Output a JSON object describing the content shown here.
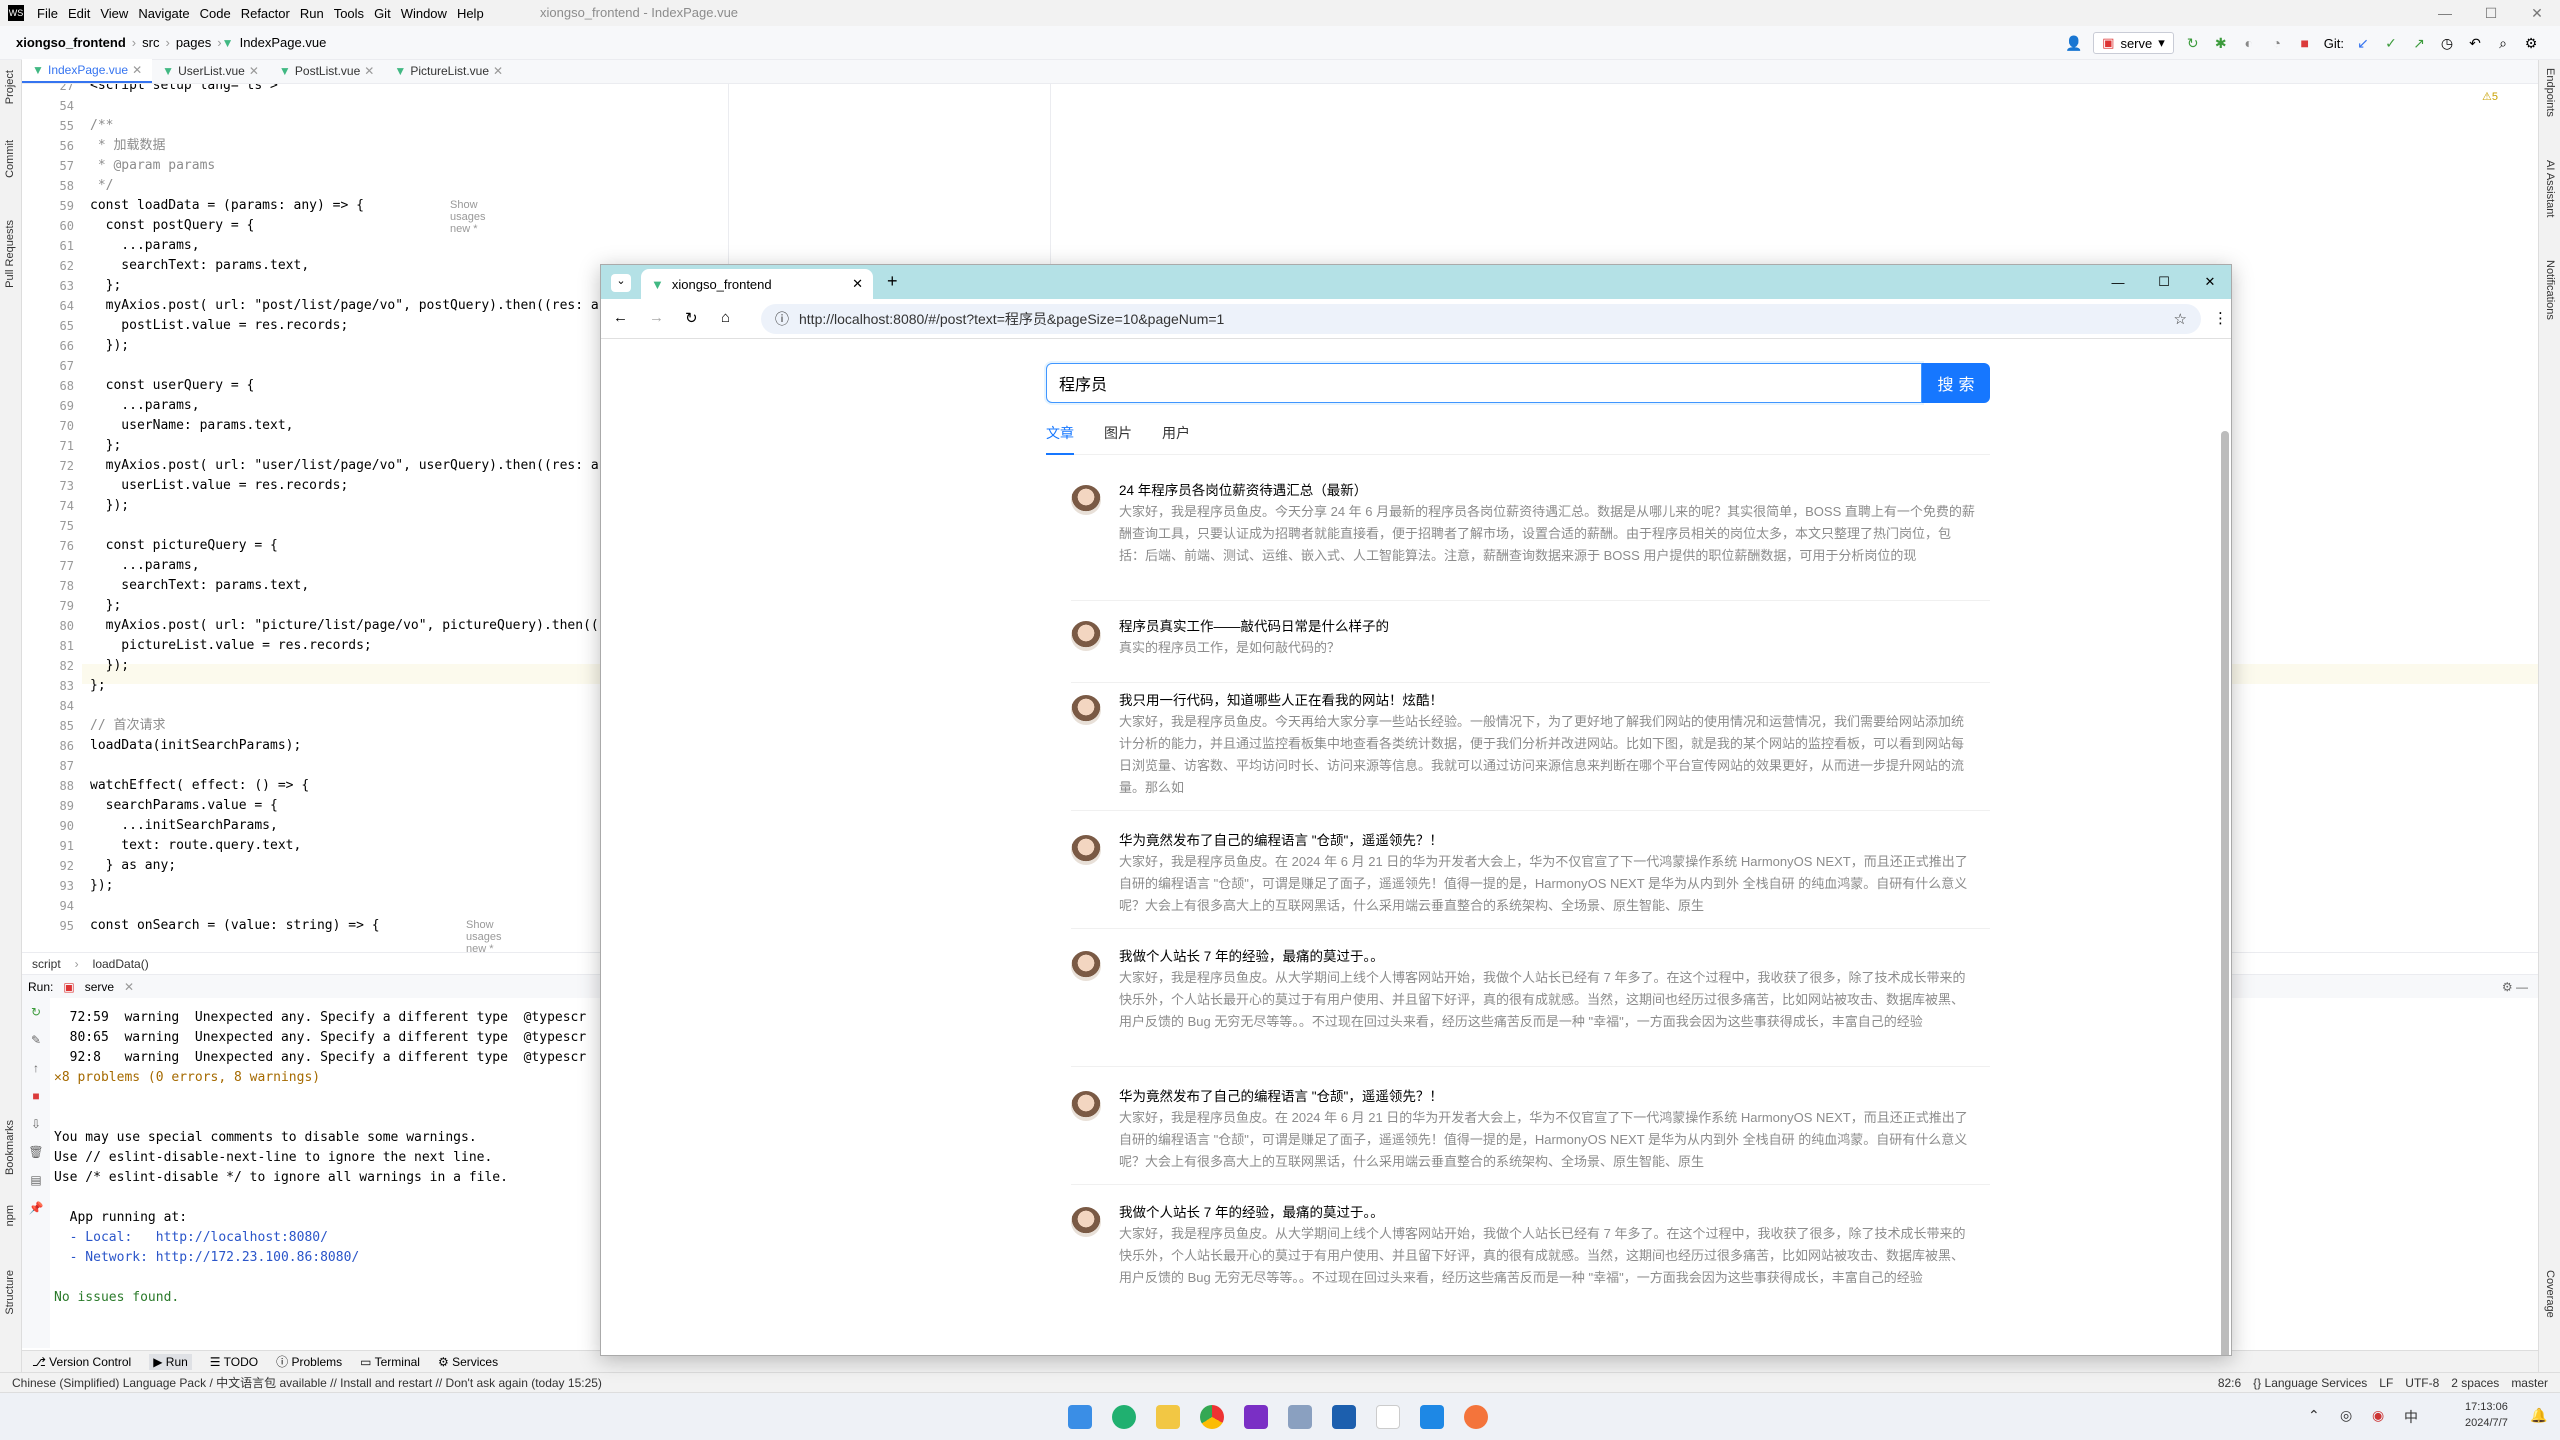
{
  "ide": {
    "menu": [
      "File",
      "Edit",
      "View",
      "Navigate",
      "Code",
      "Refactor",
      "Run",
      "Tools",
      "Git",
      "Window",
      "Help"
    ],
    "window_title": "xiongso_frontend - IndexPage.vue",
    "breadcrumb": [
      "xiongso_frontend",
      "src",
      "pages",
      "IndexPage.vue"
    ],
    "run_config": "serve",
    "git_label": "Git:",
    "tabs": [
      "IndexPage.vue",
      "UserList.vue",
      "PostList.vue",
      "PictureList.vue"
    ],
    "warnings_badge": "⚠5",
    "left_tools": [
      "Project",
      "Commit",
      "Pull Requests",
      "Bookmarks",
      "npm",
      "Structure"
    ],
    "right_tools": [
      "Endpoints",
      "AI Assistant",
      "Notifications",
      "Coverage"
    ],
    "line_numbers": [
      "27",
      "54",
      "55",
      "56",
      "57",
      "58",
      "59",
      "60",
      "61",
      "62",
      "63",
      "64",
      "65",
      "66",
      "67",
      "68",
      "69",
      "70",
      "71",
      "72",
      "73",
      "74",
      "75",
      "76",
      "77",
      "78",
      "79",
      "80",
      "81",
      "82",
      "83",
      "84",
      "85",
      "86",
      "87",
      "88",
      "89",
      "90",
      "91",
      "92",
      "93",
      "94",
      "95"
    ],
    "code_lines": [
      "<script setup lang=\"ts\">",
      "",
      "/**",
      " * 加载数据",
      " * @param params",
      " */",
      "const loadData = (params: any) => {",
      "  const postQuery = {",
      "    ...params,",
      "    searchText: params.text,",
      "  };",
      "  myAxios.post( url: \"post/list/page/vo\", postQuery).then((res: an",
      "    postList.value = res.records;",
      "  });",
      "",
      "  const userQuery = {",
      "    ...params,",
      "    userName: params.text,",
      "  };",
      "  myAxios.post( url: \"user/list/page/vo\", userQuery).then((res: an",
      "    userList.value = res.records;",
      "  });",
      "",
      "  const pictureQuery = {",
      "    ...params,",
      "    searchText: params.text,",
      "  };",
      "  myAxios.post( url: \"picture/list/page/vo\", pictureQuery).then((r",
      "    pictureList.value = res.records;",
      "  });",
      "};",
      "",
      "// 首次请求",
      "loadData(initSearchParams);",
      "",
      "watchEffect( effect: () => {",
      "  searchParams.value = {",
      "    ...initSearchParams,",
      "    text: route.query.text,",
      "  } as any;",
      "});",
      "",
      "const onSearch = (value: string) => {"
    ],
    "usage_hints": [
      "Show usages   new *",
      "Show usages   new *"
    ],
    "code_breadcrumb": [
      "script",
      "loadData()"
    ],
    "run_label": "Run:",
    "run_tab": "serve",
    "console_lines": [
      "  72:59  warning  Unexpected any. Specify a different type  @typescr",
      "  80:65  warning  Unexpected any. Specify a different type  @typescr",
      "  92:8   warning  Unexpected any. Specify a different type  @typescr",
      "✕8 problems (0 errors, 8 warnings)",
      "",
      "",
      "You may use special comments to disable some warnings.",
      "Use // eslint-disable-next-line to ignore the next line.",
      "Use /* eslint-disable */ to ignore all warnings in a file.",
      "",
      "  App running at:",
      "  - Local:   http://localhost:8080/",
      "  - Network: http://172.23.100.86:8080/",
      "",
      "No issues found."
    ],
    "bottom_tools": [
      "Version Control",
      "Run",
      "TODO",
      "Problems",
      "Terminal",
      "Services"
    ],
    "status_msg": "Chinese (Simplified) Language Pack / 中文语言包 available // Install and restart // Don't ask again (today 15:25)",
    "status_right": [
      "82:6",
      "{} Language Services",
      "LF",
      "UTF-8",
      "2 spaces",
      "master"
    ],
    "clock_time": "17:13:06",
    "clock_date": "2024/7/7"
  },
  "browser": {
    "tab_title": "xiongso_frontend",
    "url": "http://localhost:8080/#/post?text=程序员&pageSize=10&pageNum=1",
    "search_value": "程序员",
    "search_button": "搜 索",
    "tabs": [
      "文章",
      "图片",
      "用户"
    ],
    "posts": [
      {
        "title": "24 年程序员各岗位薪资待遇汇总（最新）",
        "desc": "大家好，我是程序员鱼皮。今天分享 24 年 6 月最新的程序员各岗位薪资待遇汇总。数据是从哪儿来的呢？其实很简单，BOSS 直聘上有一个免费的薪酬查询工具，只要认证成为招聘者就能直接看，便于招聘者了解市场，设置合适的薪酬。由于程序员相关的岗位太多，本文只整理了热门岗位，包括：后端、前端、测试、运维、嵌入式、人工智能算法。注意，薪酬查询数据来源于 BOSS 用户提供的职位薪酬数据，可用于分析岗位的现"
      },
      {
        "title": "程序员真实工作——敲代码日常是什么样子的",
        "desc": "真实的程序员工作，是如何敲代码的？"
      },
      {
        "title": "我只用一行代码，知道哪些人正在看我的网站！炫酷！",
        "desc": "大家好，我是程序员鱼皮。今天再给大家分享一些站长经验。一般情况下，为了更好地了解我们网站的使用情况和运营情况，我们需要给网站添加统计分析的能力，并且通过监控看板集中地查看各类统计数据，便于我们分析并改进网站。比如下图，就是我的某个网站的监控看板，可以看到网站每日浏览量、访客数、平均访问时长、访问来源等信息。我就可以通过访问来源信息来判断在哪个平台宣传网站的效果更好，从而进一步提升网站的流量。那么如"
      },
      {
        "title": "华为竟然发布了自己的编程语言 \"仓颉\"，遥遥领先？！",
        "desc": "大家好，我是程序员鱼皮。在 2024 年 6 月 21 日的华为开发者大会上，华为不仅官宣了下一代鸿蒙操作系统 HarmonyOS NEXT，而且还正式推出了自研的编程语言 \"仓颉\"，可谓是赚足了面子，遥遥领先！值得一提的是，HarmonyOS NEXT 是华为从内到外 全栈自研 的纯血鸿蒙。自研有什么意义呢？大会上有很多高大上的互联网黑话，什么采用端云垂直整合的系统架构、全场景、原生智能、原生"
      },
      {
        "title": "我做个人站长 7 年的经验，最痛的莫过于。。",
        "desc": "大家好，我是程序员鱼皮。从大学期间上线个人博客网站开始，我做个人站长已经有 7 年多了。在这个过程中，我收获了很多，除了技术成长带来的快乐外，个人站长最开心的莫过于有用户使用、并且留下好评，真的很有成就感。当然，这期间也经历过很多痛苦，比如网站被攻击、数据库被黑、用户反馈的 Bug 无穷无尽等等。。不过现在回过头来看，经历这些痛苦反而是一种 \"幸福\"，一方面我会因为这些事获得成长，丰富自己的经验"
      },
      {
        "title": "华为竟然发布了自己的编程语言 \"仓颉\"，遥遥领先？！",
        "desc": "大家好，我是程序员鱼皮。在 2024 年 6 月 21 日的华为开发者大会上，华为不仅官宣了下一代鸿蒙操作系统 HarmonyOS NEXT，而且还正式推出了自研的编程语言 \"仓颉\"，可谓是赚足了面子，遥遥领先！值得一提的是，HarmonyOS NEXT 是华为从内到外 全栈自研 的纯血鸿蒙。自研有什么意义呢？大会上有很多高大上的互联网黑话，什么采用端云垂直整合的系统架构、全场景、原生智能、原生"
      },
      {
        "title": "我做个人站长 7 年的经验，最痛的莫过于。。",
        "desc": "大家好，我是程序员鱼皮。从大学期间上线个人博客网站开始，我做个人站长已经有 7 年多了。在这个过程中，我收获了很多，除了技术成长带来的快乐外，个人站长最开心的莫过于有用户使用、并且留下好评，真的很有成就感。当然，这期间也经历过很多痛苦，比如网站被攻击、数据库被黑、用户反馈的 Bug 无穷无尽等等。。不过现在回过头来看，经历这些痛苦反而是一种 \"幸福\"，一方面我会因为这些事获得成长，丰富自己的经验"
      }
    ]
  }
}
